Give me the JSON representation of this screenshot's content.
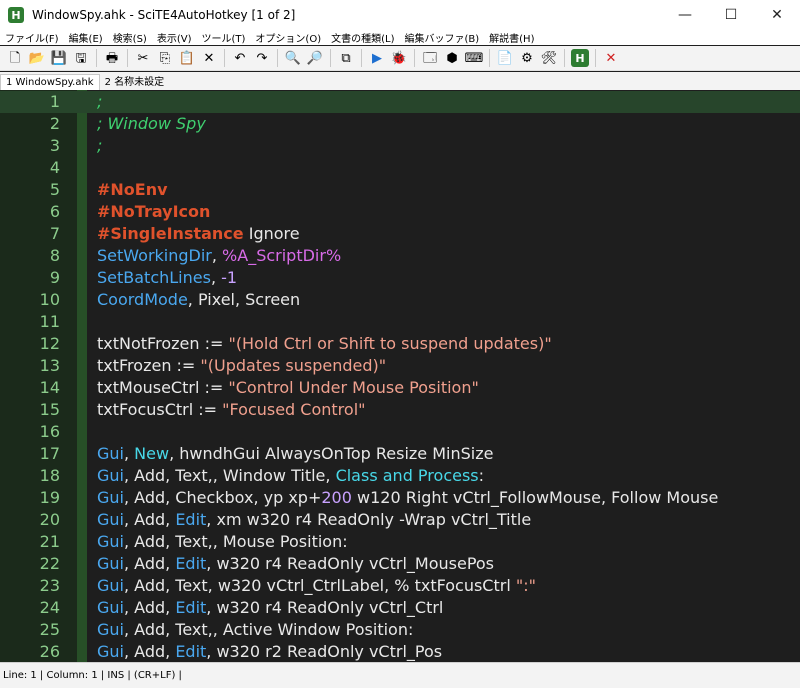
{
  "window": {
    "title": "WindowSpy.ahk - SciTE4AutoHotkey [1 of 2]",
    "app_icon": "H",
    "controls": {
      "minimize": "—",
      "maximize": "☐",
      "close": "✕"
    }
  },
  "menu": [
    "ファイル(F)",
    "編集(E)",
    "検索(S)",
    "表示(V)",
    "ツール(T)",
    "オプション(O)",
    "文書の種類(L)",
    "編集バッファ(B)",
    "解説書(H)"
  ],
  "toolbar": {
    "buttons": [
      {
        "name": "new-file-icon",
        "glyph": "🗋"
      },
      {
        "name": "open-folder-icon",
        "glyph": "📂"
      },
      {
        "name": "save-icon",
        "glyph": "💾"
      },
      {
        "name": "save-all-icon",
        "glyph": "🖫"
      },
      {
        "sep": true
      },
      {
        "name": "print-icon",
        "glyph": "🖶"
      },
      {
        "sep": true
      },
      {
        "name": "cut-icon",
        "glyph": "✂"
      },
      {
        "name": "copy-icon",
        "glyph": "⎘"
      },
      {
        "name": "paste-icon",
        "glyph": "📋"
      },
      {
        "name": "delete-icon",
        "glyph": "✕"
      },
      {
        "sep": true
      },
      {
        "name": "undo-icon",
        "glyph": "↶"
      },
      {
        "name": "redo-icon",
        "glyph": "↷"
      },
      {
        "sep": true
      },
      {
        "name": "find-icon",
        "glyph": "🔍"
      },
      {
        "name": "replace-icon",
        "glyph": "🔎"
      },
      {
        "sep": true
      },
      {
        "name": "compare-icon",
        "glyph": "⧉"
      },
      {
        "sep": true
      },
      {
        "name": "run-icon",
        "glyph": "▶"
      },
      {
        "name": "debug-icon",
        "glyph": "🐞"
      },
      {
        "sep": true
      },
      {
        "name": "window-spy-icon",
        "glyph": "🗔"
      },
      {
        "name": "box-icon",
        "glyph": "⬢"
      },
      {
        "name": "keyboard-icon",
        "glyph": "⌨"
      },
      {
        "sep": true
      },
      {
        "name": "script-icon",
        "glyph": "📄"
      },
      {
        "name": "settings-icon",
        "glyph": "⚙"
      },
      {
        "name": "tools-icon",
        "glyph": "🛠"
      },
      {
        "sep": true
      },
      {
        "name": "ahk-icon",
        "glyph": "H"
      },
      {
        "sep": true
      },
      {
        "name": "close-x-icon",
        "glyph": "✕"
      }
    ],
    "colors": {
      "run": "#1e6fd0",
      "debug": "#2e8b2e",
      "ahk": "#2e7d32",
      "close_x": "#d02020"
    }
  },
  "tabs": [
    {
      "label": "1 WindowSpy.ahk",
      "active": true
    },
    {
      "label": "2 名称未設定",
      "active": false
    }
  ],
  "editor": {
    "current_line": 1,
    "lines": [
      [
        {
          "t": ";",
          "c": "comment"
        }
      ],
      [
        {
          "t": "; Window Spy",
          "c": "comment"
        }
      ],
      [
        {
          "t": ";",
          "c": "comment"
        }
      ],
      [],
      [
        {
          "t": "#NoEnv",
          "c": "directive"
        }
      ],
      [
        {
          "t": "#NoTrayIcon",
          "c": "directive"
        }
      ],
      [
        {
          "t": "#SingleInstance",
          "c": "directive"
        },
        {
          "t": " Ignore",
          "c": "id"
        }
      ],
      [
        {
          "t": "SetWorkingDir",
          "c": "func"
        },
        {
          "t": ", ",
          "c": "op"
        },
        {
          "t": "%A_ScriptDir%",
          "c": "var"
        }
      ],
      [
        {
          "t": "SetBatchLines",
          "c": "func"
        },
        {
          "t": ", ",
          "c": "op"
        },
        {
          "t": "-1",
          "c": "num"
        }
      ],
      [
        {
          "t": "CoordMode",
          "c": "func"
        },
        {
          "t": ", Pixel, Screen",
          "c": "id"
        }
      ],
      [],
      [
        {
          "t": "txtNotFrozen := ",
          "c": "id"
        },
        {
          "t": "\"(Hold Ctrl or Shift to suspend updates)\"",
          "c": "str"
        }
      ],
      [
        {
          "t": "txtFrozen := ",
          "c": "id"
        },
        {
          "t": "\"(Updates suspended)\"",
          "c": "str"
        }
      ],
      [
        {
          "t": "txtMouseCtrl := ",
          "c": "id"
        },
        {
          "t": "\"Control Under Mouse Position\"",
          "c": "str"
        }
      ],
      [
        {
          "t": "txtFocusCtrl := ",
          "c": "id"
        },
        {
          "t": "\"Focused Control\"",
          "c": "str"
        }
      ],
      [],
      [
        {
          "t": "Gui",
          "c": "gui"
        },
        {
          "t": ", ",
          "c": "op"
        },
        {
          "t": "New",
          "c": "guisub"
        },
        {
          "t": ", hwndhGui AlwaysOnTop Resize MinSize",
          "c": "id"
        }
      ],
      [
        {
          "t": "Gui",
          "c": "gui"
        },
        {
          "t": ", Add, Text,, Window Title, ",
          "c": "id"
        },
        {
          "t": "Class and Process",
          "c": "guisub"
        },
        {
          "t": ":",
          "c": "id"
        }
      ],
      [
        {
          "t": "Gui",
          "c": "gui"
        },
        {
          "t": ", Add, Checkbox, yp xp+",
          "c": "id"
        },
        {
          "t": "200",
          "c": "num"
        },
        {
          "t": " w120 Right vCtrl_FollowMouse, Follow Mouse",
          "c": "id"
        }
      ],
      [
        {
          "t": "Gui",
          "c": "gui"
        },
        {
          "t": ", Add, ",
          "c": "id"
        },
        {
          "t": "Edit",
          "c": "func"
        },
        {
          "t": ", xm w320 r4 ReadOnly -Wrap vCtrl_Title",
          "c": "id"
        }
      ],
      [
        {
          "t": "Gui",
          "c": "gui"
        },
        {
          "t": ", Add, Text,, Mouse Position:",
          "c": "id"
        }
      ],
      [
        {
          "t": "Gui",
          "c": "gui"
        },
        {
          "t": ", Add, ",
          "c": "id"
        },
        {
          "t": "Edit",
          "c": "func"
        },
        {
          "t": ", w320 r4 ReadOnly vCtrl_MousePos",
          "c": "id"
        }
      ],
      [
        {
          "t": "Gui",
          "c": "gui"
        },
        {
          "t": ", Add, Text, w320 vCtrl_CtrlLabel, % txtFocusCtrl ",
          "c": "id"
        },
        {
          "t": "\":\"",
          "c": "str"
        }
      ],
      [
        {
          "t": "Gui",
          "c": "gui"
        },
        {
          "t": ", Add, ",
          "c": "id"
        },
        {
          "t": "Edit",
          "c": "func"
        },
        {
          "t": ", w320 r4 ReadOnly vCtrl_Ctrl",
          "c": "id"
        }
      ],
      [
        {
          "t": "Gui",
          "c": "gui"
        },
        {
          "t": ", Add, Text,, Active Window Position:",
          "c": "id"
        }
      ],
      [
        {
          "t": "Gui",
          "c": "gui"
        },
        {
          "t": ", Add, ",
          "c": "id"
        },
        {
          "t": "Edit",
          "c": "func"
        },
        {
          "t": ", w320 r2 ReadOnly vCtrl_Pos",
          "c": "id"
        }
      ]
    ]
  },
  "status": "Line: 1 | Column: 1 | INS | (CR+LF) |"
}
